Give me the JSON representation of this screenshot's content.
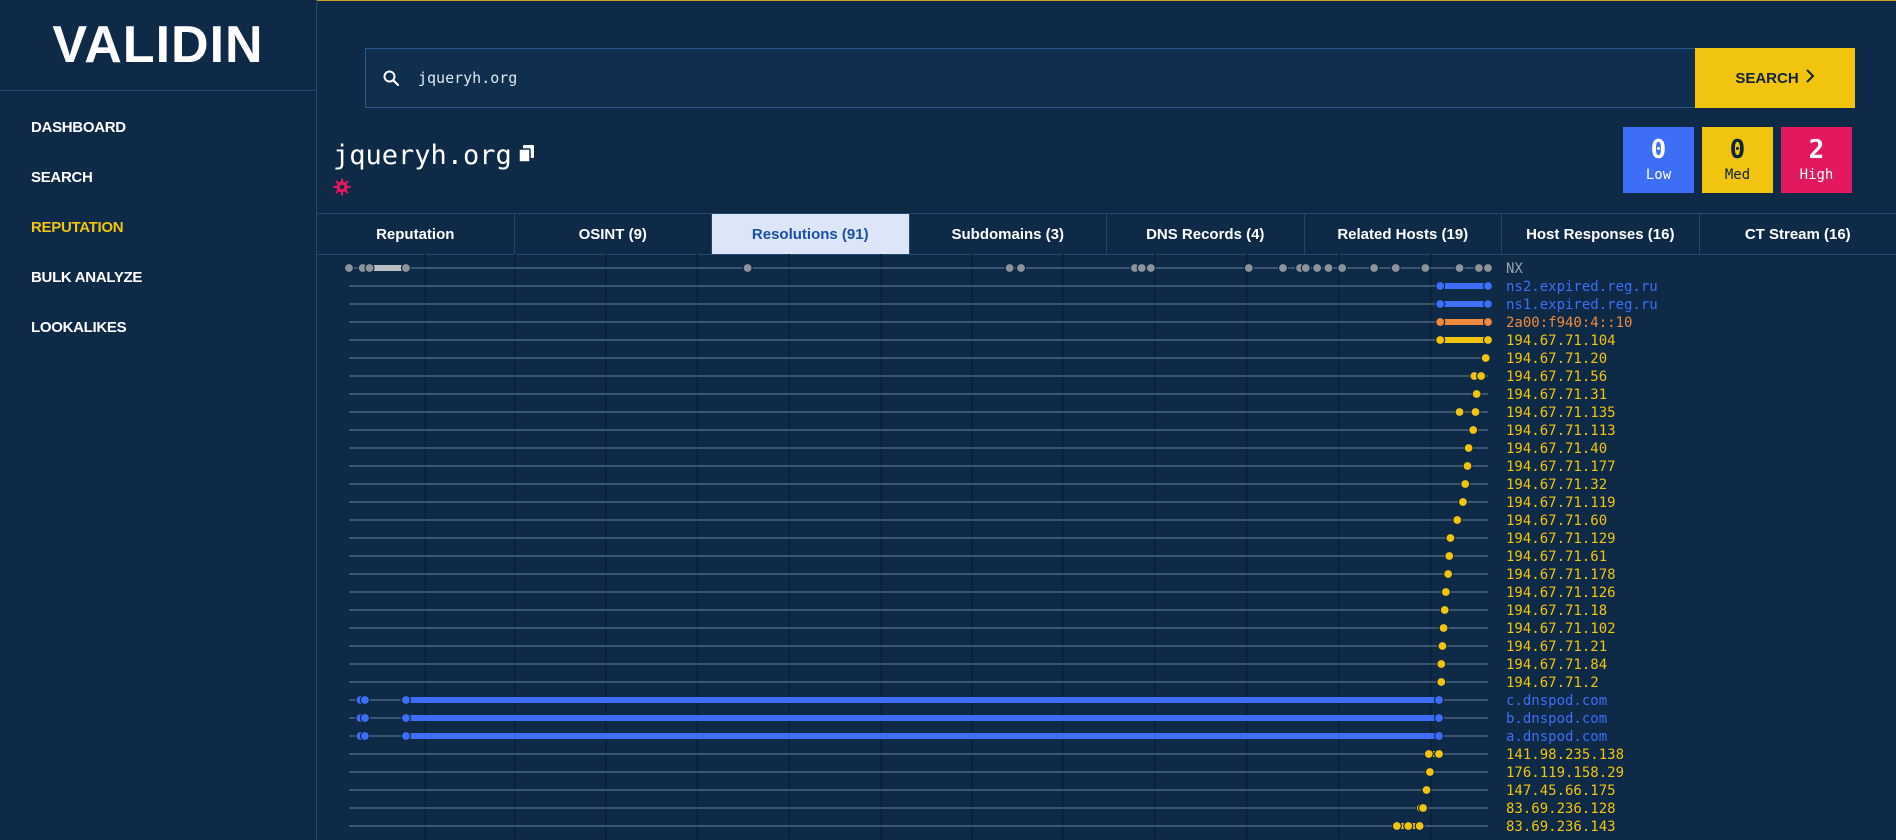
{
  "brand": {
    "logo_text": "VALIDIN"
  },
  "sidebar": {
    "items": [
      {
        "label": "DASHBOARD",
        "active": false
      },
      {
        "label": "SEARCH",
        "active": false
      },
      {
        "label": "REPUTATION",
        "active": true
      },
      {
        "label": "BULK ANALYZE",
        "active": false
      },
      {
        "label": "LOOKALIKES",
        "active": false
      }
    ]
  },
  "search": {
    "value": "jqueryh.org",
    "button_label": "SEARCH"
  },
  "domain": {
    "title": "jqueryh.org"
  },
  "counters": [
    {
      "count": "0",
      "label": "Low",
      "color": "#3d6ef5"
    },
    {
      "count": "0",
      "label": "Med",
      "color": "#f1c40f"
    },
    {
      "count": "2",
      "label": "High",
      "color": "#e2195e"
    }
  ],
  "tabs": [
    {
      "label": "Reputation",
      "active": false
    },
    {
      "label": "OSINT (9)",
      "active": false
    },
    {
      "label": "Resolutions (91)",
      "active": true
    },
    {
      "label": "Subdomains (3)",
      "active": false
    },
    {
      "label": "DNS Records (4)",
      "active": false
    },
    {
      "label": "Related Hosts (19)",
      "active": false
    },
    {
      "label": "Host Responses (16)",
      "active": false
    },
    {
      "label": "CT Stream (16)",
      "active": false
    }
  ],
  "colors": {
    "background": "#0f2a47",
    "accent": "#f1c40f",
    "nameserver": "#3d6ef5",
    "ipv6": "#f08a3c",
    "ipv4": "#f1c40f",
    "nx": "#9aa3ad"
  },
  "resolutions": [
    {
      "label": "NX",
      "kind": "nx",
      "points": [
        0.0,
        0.012,
        0.018,
        0.05,
        0.35,
        0.58,
        0.59,
        0.69,
        0.696,
        0.704,
        0.79,
        0.82,
        0.835,
        0.84,
        0.85,
        0.86,
        0.872,
        0.9,
        0.919,
        0.945,
        0.975,
        0.992,
        1.0
      ],
      "bar": [
        0.012,
        0.05
      ]
    },
    {
      "label": "ns2.expired.reg.ru",
      "kind": "ns",
      "points": [
        0.958,
        1.0
      ],
      "bar": [
        0.958,
        1.0
      ]
    },
    {
      "label": "ns1.expired.reg.ru",
      "kind": "ns",
      "points": [
        0.958,
        1.0
      ],
      "bar": [
        0.958,
        1.0
      ]
    },
    {
      "label": "2a00:f940:4::10",
      "kind": "ipv6",
      "points": [
        0.958,
        1.0
      ],
      "bar": [
        0.958,
        1.0
      ]
    },
    {
      "label": "194.67.71.104",
      "kind": "ipv4",
      "points": [
        0.958,
        1.0
      ],
      "bar": [
        0.958,
        1.0
      ]
    },
    {
      "label": "194.67.71.20",
      "kind": "ipv4",
      "points": [
        0.998
      ],
      "bar": null
    },
    {
      "label": "194.67.71.56",
      "kind": "ipv4",
      "points": [
        0.988,
        0.994
      ],
      "bar": null
    },
    {
      "label": "194.67.71.31",
      "kind": "ipv4",
      "points": [
        0.99
      ],
      "bar": null
    },
    {
      "label": "194.67.71.135",
      "kind": "ipv4",
      "points": [
        0.975,
        0.989
      ],
      "bar": null
    },
    {
      "label": "194.67.71.113",
      "kind": "ipv4",
      "points": [
        0.987
      ],
      "bar": null
    },
    {
      "label": "194.67.71.40",
      "kind": "ipv4",
      "points": [
        0.983
      ],
      "bar": null
    },
    {
      "label": "194.67.71.177",
      "kind": "ipv4",
      "points": [
        0.982
      ],
      "bar": null
    },
    {
      "label": "194.67.71.32",
      "kind": "ipv4",
      "points": [
        0.98
      ],
      "bar": null
    },
    {
      "label": "194.67.71.119",
      "kind": "ipv4",
      "points": [
        0.978
      ],
      "bar": null
    },
    {
      "label": "194.67.71.60",
      "kind": "ipv4",
      "points": [
        0.973
      ],
      "bar": null
    },
    {
      "label": "194.67.71.129",
      "kind": "ipv4",
      "points": [
        0.967
      ],
      "bar": null
    },
    {
      "label": "194.67.71.61",
      "kind": "ipv4",
      "points": [
        0.966
      ],
      "bar": null
    },
    {
      "label": "194.67.71.178",
      "kind": "ipv4",
      "points": [
        0.965
      ],
      "bar": null
    },
    {
      "label": "194.67.71.126",
      "kind": "ipv4",
      "points": [
        0.963
      ],
      "bar": null
    },
    {
      "label": "194.67.71.18",
      "kind": "ipv4",
      "points": [
        0.962
      ],
      "bar": null
    },
    {
      "label": "194.67.71.102",
      "kind": "ipv4",
      "points": [
        0.961
      ],
      "bar": null
    },
    {
      "label": "194.67.71.21",
      "kind": "ipv4",
      "points": [
        0.96
      ],
      "bar": null
    },
    {
      "label": "194.67.71.84",
      "kind": "ipv4",
      "points": [
        0.959
      ],
      "bar": null
    },
    {
      "label": "194.67.71.2",
      "kind": "ipv4",
      "points": [
        0.959
      ],
      "bar": null
    },
    {
      "label": "c.dnspod.com",
      "kind": "ns",
      "points": [
        0.01,
        0.014,
        0.05,
        0.957
      ],
      "bar": [
        0.05,
        0.957
      ]
    },
    {
      "label": "b.dnspod.com",
      "kind": "ns",
      "points": [
        0.01,
        0.014,
        0.05,
        0.957
      ],
      "bar": [
        0.05,
        0.957
      ]
    },
    {
      "label": "a.dnspod.com",
      "kind": "ns",
      "points": [
        0.01,
        0.014,
        0.05,
        0.957
      ],
      "bar": [
        0.05,
        0.957
      ]
    },
    {
      "label": "141.98.235.138",
      "kind": "ipv4",
      "points": [
        0.948,
        0.957
      ],
      "bar": [
        0.948,
        0.957
      ]
    },
    {
      "label": "176.119.158.29",
      "kind": "ipv4",
      "points": [
        0.949
      ],
      "bar": null
    },
    {
      "label": "147.45.66.175",
      "kind": "ipv4",
      "points": [
        0.946
      ],
      "bar": null
    },
    {
      "label": "83.69.236.128",
      "kind": "ipv4",
      "points": [
        0.941,
        0.943
      ],
      "bar": null
    },
    {
      "label": "83.69.236.143",
      "kind": "ipv4",
      "points": [
        0.92,
        0.93,
        0.94
      ],
      "bar": [
        0.92,
        0.94
      ]
    }
  ]
}
